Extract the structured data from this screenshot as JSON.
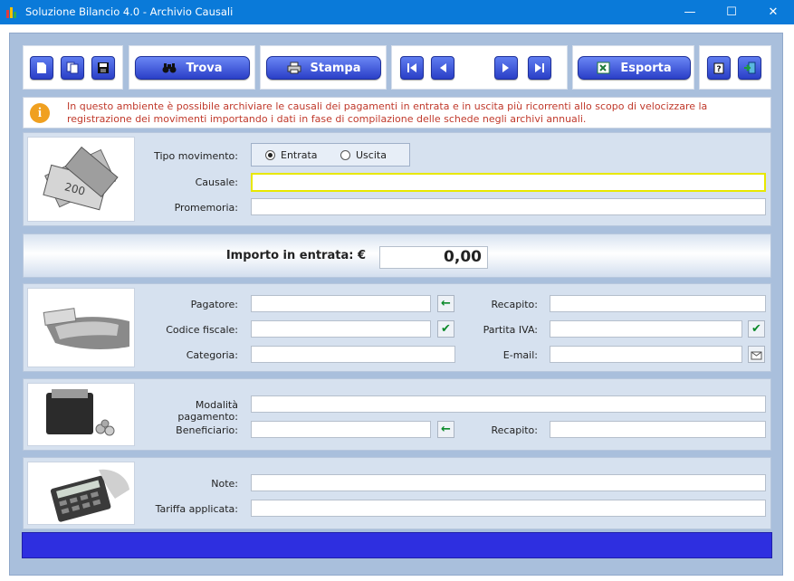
{
  "window": {
    "title": "Soluzione Bilancio 4.0 - Archivio Causali",
    "minimize": "—",
    "maximize": "☐",
    "close": "✕"
  },
  "toolbar": {
    "new_icon": "new-document-icon",
    "copy_icon": "copy-icon",
    "save_icon": "save-icon",
    "find_label": "Trova",
    "print_label": "Stampa",
    "first_icon": "first-record-icon",
    "prev_icon": "previous-record-icon",
    "next_icon": "next-record-icon",
    "last_icon": "last-record-icon",
    "export_label": "Esporta",
    "help_icon": "help-icon",
    "exit_icon": "exit-icon"
  },
  "info": {
    "text": "In questo ambiente è possibile archiviare le causali dei pagamenti in entrata e in uscita più ricorrenti allo scopo di velocizzare la registrazione dei movimenti importando i dati in fase di compilazione delle schede negli archivi annuali."
  },
  "movimento": {
    "tipo_label": "Tipo movimento:",
    "option_entrata": "Entrata",
    "option_uscita": "Uscita",
    "selected": "Entrata",
    "causale_label": "Causale:",
    "causale_value": "",
    "promemoria_label": "Promemoria:",
    "promemoria_value": ""
  },
  "importo": {
    "label": "Importo in entrata: €",
    "value": "0,00"
  },
  "pagatore": {
    "pagatore_label": "Pagatore:",
    "recapito_label": "Recapito:",
    "codice_fiscale_label": "Codice fiscale:",
    "partita_iva_label": "Partita IVA:",
    "categoria_label": "Categoria:",
    "email_label": "E-mail:"
  },
  "pagamento": {
    "modalita_label": "Modalità pagamento:",
    "beneficiario_label": "Beneficiario:",
    "recapito_label": "Recapito:"
  },
  "note": {
    "note_label": "Note:",
    "tariffa_label": "Tariffa applicata:"
  },
  "colors": {
    "titlebar": "#0a7ad9",
    "frame": "#a9bfdc",
    "panel": "#d6e1ef",
    "button": "#2a3fc7",
    "info_text": "#c0392b",
    "status_bar": "#2e2fe0",
    "focus_border": "#e8e800",
    "check_green": "#0c8a2a"
  }
}
